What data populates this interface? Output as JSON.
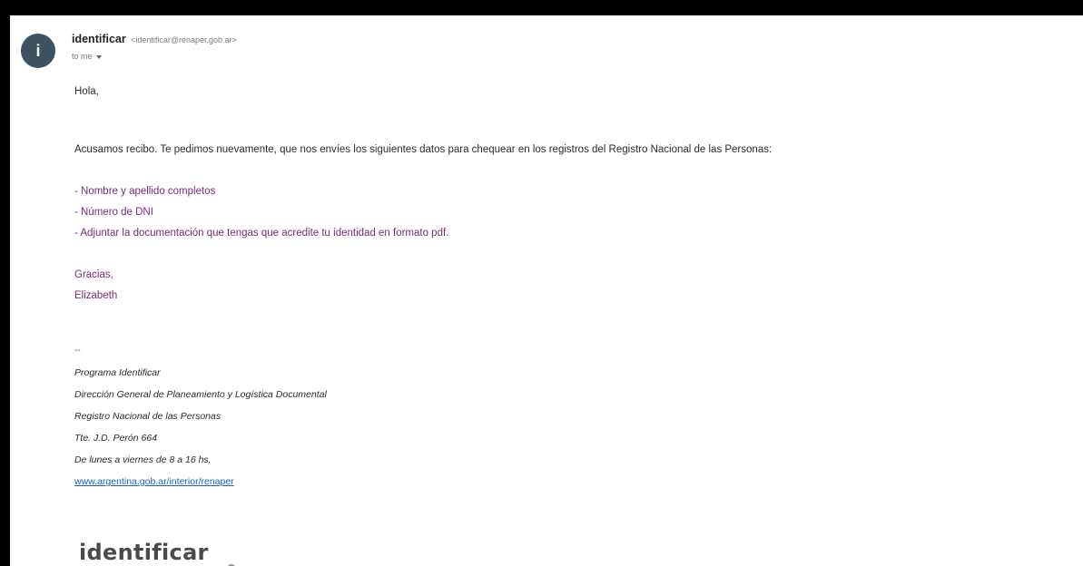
{
  "sender": {
    "avatar_letter": "i",
    "name": "identificar",
    "email": "<identificar@renaper.gob.ar>",
    "to_label": "to me"
  },
  "message": {
    "greeting": "Hola,",
    "intro": "Acusamos recibo. Te pedimos nuevamente, que nos envíes los siguientes datos para chequear en los registros del Registro Nacional de las Personas:",
    "items": [
      "- Nombre y apellido completos",
      "- Número de DNI",
      "- Adjuntar la documentación que tengas que acredite tu identidad en formato pdf."
    ],
    "thanks": "Gracias,",
    "signer": "Elizabeth"
  },
  "signature": {
    "separator": "--",
    "lines": [
      "Programa Identificar",
      "Dirección General de Planeamiento y Logística Documental",
      "Registro Nacional de las Personas",
      "Tte. J.D. Perón 664",
      "De lunes a viernes de 8 a 16 hs."
    ],
    "link": "www.argentina.gob.ar/interior/renaper",
    "logo_text": "identificar"
  },
  "colors": {
    "avatar_bg": "#3e5361",
    "purple_text": "#7b2a7b",
    "link": "#1a5fc7"
  }
}
